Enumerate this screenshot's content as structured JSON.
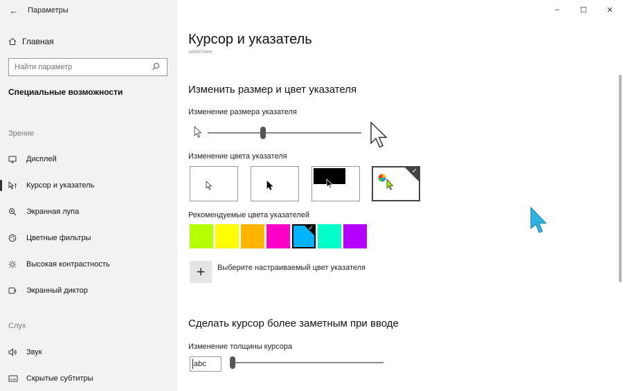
{
  "window": {
    "app_title": "Параметры",
    "controls": {
      "minimize": "–",
      "maximize": "☐",
      "close": "✕"
    }
  },
  "sidebar": {
    "home_label": "Главная",
    "search": {
      "placeholder": "Найти параметр",
      "icon": "search-icon"
    },
    "section_title": "Специальные возможности",
    "group_vision": "Зрение",
    "group_hearing": "Слух",
    "items": [
      {
        "label": "Дисплей",
        "icon": "display-icon"
      },
      {
        "label": "Курсор и указатель",
        "icon": "cursor-icon",
        "active": true
      },
      {
        "label": "Экранная лупа",
        "icon": "magnifier-icon"
      },
      {
        "label": "Цветные фильтры",
        "icon": "color-filter-icon"
      },
      {
        "label": "Высокая контрастность",
        "icon": "contrast-icon"
      },
      {
        "label": "Экранный диктор",
        "icon": "narrator-icon"
      },
      {
        "label": "Звук",
        "icon": "speaker-icon"
      },
      {
        "label": "Скрытые субтитры",
        "icon": "captions-icon"
      }
    ]
  },
  "main": {
    "page_title": "Курсор и указатель",
    "cut_text": "заметнее",
    "section1_title": "Изменить размер и цвет указателя",
    "size_label": "Изменение размера указателя",
    "size_slider_fraction": 0.36,
    "color_label": "Изменение цвета указателя",
    "color_options": [
      "white",
      "black",
      "inverted",
      "custom"
    ],
    "selected_color_option": "custom",
    "recommended_label": "Рекомендуемые цвета указателей",
    "recommended_colors": [
      "#b4ff00",
      "#ffff00",
      "#ffb400",
      "#ff00c8",
      "#00b4ff",
      "#00ffc8",
      "#b400ff"
    ],
    "selected_recommended": "#00b4ff",
    "custom_color_label": "Выберите настраиваемый цвет указателя",
    "section2_title": "Сделать курсор более заметным при вводе",
    "thickness_label": "Изменение толщины курсора",
    "thickness_preview": "abc",
    "thickness_slider_fraction": 0.0
  },
  "colors": {
    "sidebar_bg": "#f2f2f2",
    "accent_cursor": "#2fb4e6"
  }
}
